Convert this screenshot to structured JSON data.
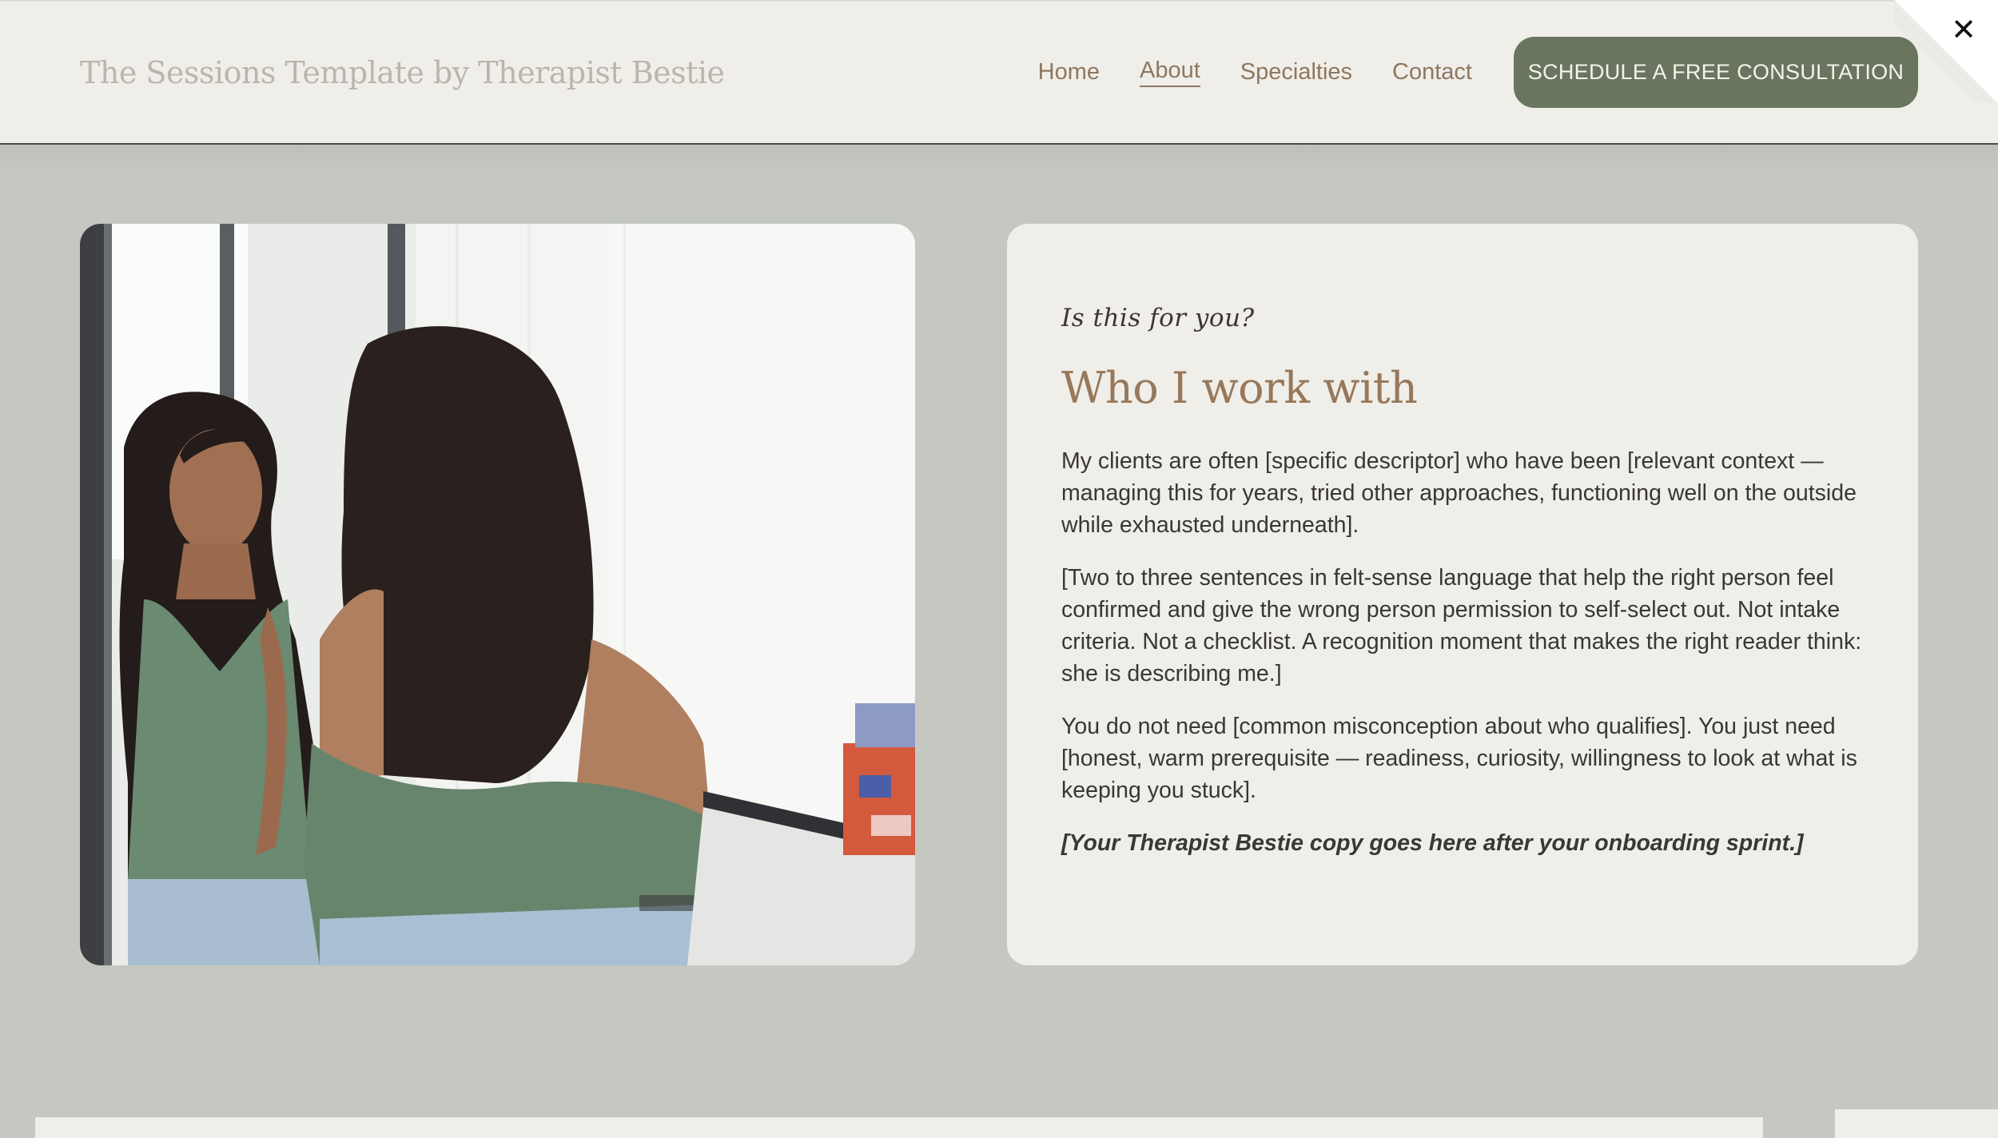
{
  "header": {
    "site_title": "The Sessions Template by Therapist Bestie",
    "nav": [
      {
        "label": "Home",
        "active": false
      },
      {
        "label": "About",
        "active": true
      },
      {
        "label": "Specialties",
        "active": false
      },
      {
        "label": "Contact",
        "active": false
      }
    ],
    "cta_label": "SCHEDULE A FREE CONSULTATION",
    "close_glyph": "✕"
  },
  "main": {
    "eyebrow": "Is this for you?",
    "heading": "Who I work with",
    "paragraphs": [
      "My clients are often [specific descriptor] who have been [relevant context — managing this for years, tried other approaches, functioning well on the outside while exhausted underneath].",
      "[Two to three sentences in felt-sense language that help the right person feel confirmed and give the wrong person permission to self-select out. Not intake criteria. Not a checklist. A recognition moment that makes the right reader think: she is describing me.]",
      "You do not need [common misconception about who qualifies]. You just need [honest, warm prerequisite — readiness, curiosity, willingness to look at what is keeping you stuck]."
    ],
    "note": "[Your Therapist Bestie copy goes here after your onboarding sprint.]"
  },
  "colors": {
    "background": "#c4c8c0",
    "card": "#f0eee9",
    "accent_green": "#6a755f",
    "heading_brown": "#97785a",
    "nav_brown": "#8e775f"
  },
  "icons": {
    "close": "close-icon"
  }
}
